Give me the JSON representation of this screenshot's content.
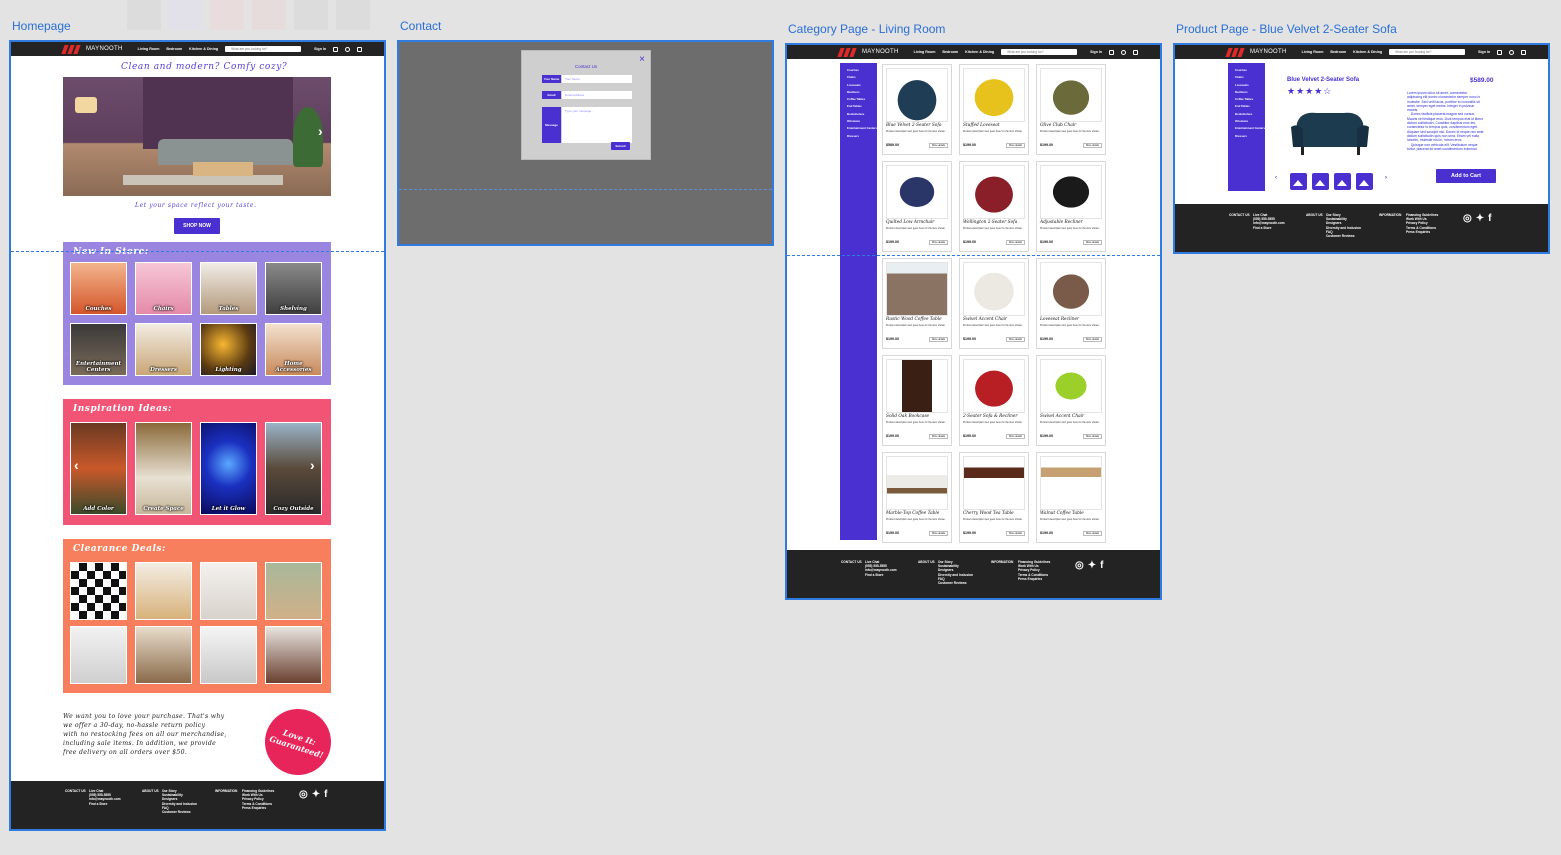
{
  "canvas": {
    "frames": {
      "homepage": "Homepage",
      "contact": "Contact",
      "category": "Category Page - Living Room",
      "product": "Product Page - Blue Velvet 2-Seater Sofa"
    }
  },
  "header": {
    "logo": "MAYNOOTH",
    "nav": [
      "Living Room",
      "Bedroom",
      "Kitchen & Dining"
    ],
    "search_placeholder": "What are you looking for?",
    "account_link": "Sign In"
  },
  "homepage": {
    "tagline": "Clean and modern? Comfy cozy?",
    "subtitle": "Let your space reflect your taste.",
    "shop_button": "SHOP NOW",
    "new_in_store": {
      "title": "New In Store:",
      "tiles": [
        "Couches",
        "Chairs",
        "Tables",
        "Shelving",
        "Entertainment Centers",
        "Dressers",
        "Lighting",
        "Home Accessories"
      ]
    },
    "inspiration": {
      "title": "Inspiration Ideas:",
      "tiles": [
        "Add Color",
        "Create Space",
        "Let it Glow",
        "Cozy Outside"
      ]
    },
    "clearance": {
      "title": "Clearance Deals:"
    },
    "guarantee_text": "We want you to love your purchase. That's why\nwe offer a 30-day, no-hassle return policy\nwith no restocking fees on all our merchandise,\nincluding sale items. In addition, we provide\nfree delivery on all orders over $50.",
    "seal_text": "Love It:\nGuaranteed!"
  },
  "footer": {
    "contact_heading": "CONTACT US",
    "contact_lines": "Live Chat\n(555) 555-5555\ninfo@maynooth.com\nFind a Store",
    "about_heading": "ABOUT US",
    "about_lines": "Our Story\nSustainability\nDesigners\nDiversity and Inclusion\nFAQ\nCustomer Reviews",
    "info_heading": "INFORMATION",
    "info_lines": "Financing Guidelines\nWork With Us\nPrivacy Policy\nTerms & Conditions\nPress Enquiries",
    "social": [
      "instagram-icon",
      "twitter-icon",
      "facebook-icon"
    ]
  },
  "contact": {
    "title": "Contact Us",
    "fields": [
      {
        "label": "Your Name",
        "placeholder": "Your Name"
      },
      {
        "label": "Email",
        "placeholder": "Email Address"
      },
      {
        "label": "Message",
        "placeholder": "Type your message..."
      }
    ],
    "submit": "Submit"
  },
  "category": {
    "sidebar": [
      "Couches",
      "Chairs",
      "Loveseats",
      "Recliners",
      "Coffee Tables",
      "End Tables",
      "Bookshelves",
      "Ottomans",
      "Entertainment Centers",
      "Dressers"
    ],
    "products": [
      {
        "name": "Blue Velvet 2-Seater Sofa",
        "price": "$589.00"
      },
      {
        "name": "Stuffed Loveseat",
        "price": "$199.00"
      },
      {
        "name": "Olive Club Chair",
        "price": "$199.00"
      },
      {
        "name": "Quilted Low Armchair",
        "price": "$199.00"
      },
      {
        "name": "Wellington 2-Seater Sofa",
        "price": "$199.00"
      },
      {
        "name": "Adjustable Recliner",
        "price": "$199.00"
      },
      {
        "name": "Rustic Wood Coffee Table",
        "price": "$199.00"
      },
      {
        "name": "Swivel Accent Chair",
        "price": "$199.00"
      },
      {
        "name": "Loveseat Recliner",
        "price": "$199.00"
      },
      {
        "name": "Solid Oak Bookcase",
        "price": "$199.00"
      },
      {
        "name": "2-Seater Sofa & Recliner",
        "price": "$199.00"
      },
      {
        "name": "Swivel Accent Chair",
        "price": "$199.00"
      },
      {
        "name": "Marble-Top Coffee Table",
        "price": "$199.00"
      },
      {
        "name": "Cherry Wood Tea Table",
        "price": "$199.00"
      },
      {
        "name": "Walnut Coffee Table",
        "price": "$199.00"
      }
    ],
    "product_desc": "Product description text goes here for the item shown.",
    "details_button": "More details"
  },
  "product": {
    "name": "Blue Velvet 2-Seater Sofa",
    "price": "$589.00",
    "stars": "★★★★☆",
    "description": "Lorem ipsum dolor sit amet, consectetur\nadipiscing elit donec consectetur semper nunc in\nmolestie. Sed velit lacus, porttitor eu convallis sit\namet, semper eget metus. Integer in pulvinar\nmauris.\n    Donec facilisis placerat magna sed cursus.\nMauris vel tristique eros. Duis tempus erat id libero\ndictum sollicitudin. Curabitur dapibus eros leo,\nconsectetur in tempus quis, condimentum eget.\nAliquam sed suscipit nisi. Donec id neque nec ante\ndictum sollicitudin quis non urna. Etiam vel nulla\nlobortis, molestie nisl in, rutrum eros.\n    Quisque non vehicula elit. Vestibulum neque\ntortor, placerat sit amet condimentum euismod.",
    "add_to_cart": "Add to Cart"
  },
  "colors": {
    "accent": "#4a2fd1",
    "header_footer": "#232323",
    "new_in_store_bg": "#9a86e0",
    "inspiration_bg": "#f25475",
    "clearance_bg": "#f77f5e",
    "seal": "#e8255a",
    "selection": "#2f7be0"
  }
}
